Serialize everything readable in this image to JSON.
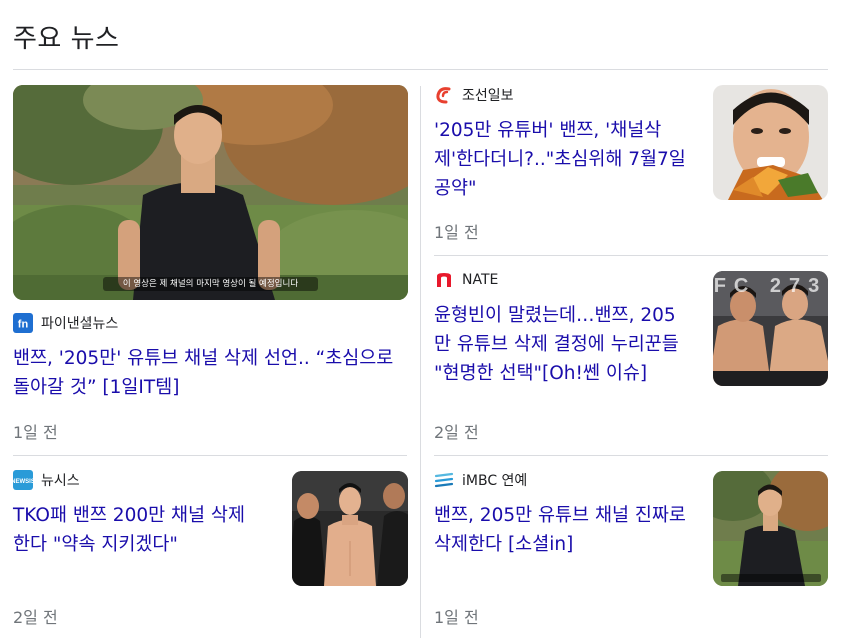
{
  "section": {
    "title": "주요 뉴스"
  },
  "articles": [
    {
      "source": "파이낸셜뉴스",
      "headline_lines": [
        "밴쯔, '205만' 유튜브 채널 삭제 선언.. “초심으로",
        "돌아갈 것” [1일IT템]"
      ],
      "time": "1일 전",
      "image_caption": "이 영상은 제 채널의 마지막 영상이 될 예정입니다"
    },
    {
      "source": "조선일보",
      "headline_lines": [
        "'205만 유튜버' 밴쯔, '채널삭",
        "제'한다더니?..\"초심위해 7월7일",
        "공약\""
      ],
      "time": "1일 전"
    },
    {
      "source": "NATE",
      "headline_lines": [
        "윤형빈이 말렸는데…밴쯔, 205",
        "만 유튜브 삭제 결정에 누리꾼들",
        "\"현명한 선택\"[Oh!쎈 이슈]"
      ],
      "time": "2일 전",
      "image_text": "FC 273"
    },
    {
      "source": "뉴시스",
      "headline_lines": [
        "TKO패 밴쯔 200만 채널 삭제",
        "한다 \"약속 지키겠다\""
      ],
      "time": "2일 전"
    },
    {
      "source": "iMBC 연예",
      "headline_lines": [
        "밴쯔, 205만 유튜브 채널 진짜로",
        "삭제한다 [소셜in]"
      ],
      "time": "1일 전"
    }
  ],
  "colors": {
    "link": "#1a0dab",
    "meta": "#70757a",
    "divider": "#dadce0",
    "chosun_logo": "#e8402f",
    "nate_logo": "#e8192c",
    "fnnews_logo": "#1f6fd1",
    "newsis_logo": "#2a9bd8"
  }
}
